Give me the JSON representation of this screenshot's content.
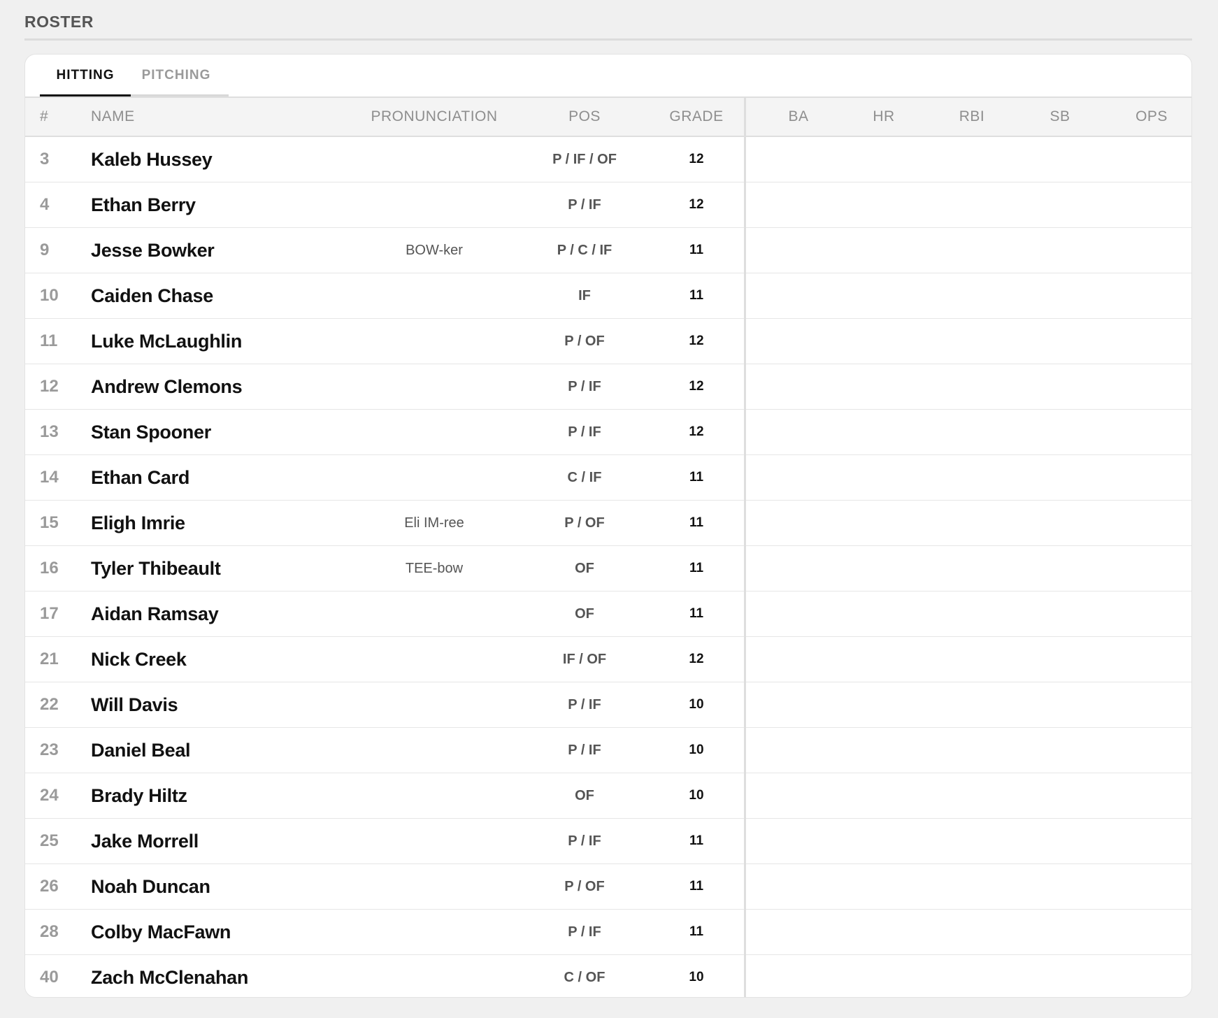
{
  "section": {
    "title": "ROSTER"
  },
  "tabs": [
    {
      "label": "HITTING",
      "active": true
    },
    {
      "label": "PITCHING",
      "active": false
    }
  ],
  "columns": {
    "num": "#",
    "name": "NAME",
    "pronunciation": "PRONUNCIATION",
    "pos": "POS",
    "grade": "GRADE",
    "ba": "BA",
    "hr": "HR",
    "rbi": "RBI",
    "sb": "SB",
    "ops": "OPS"
  },
  "players": [
    {
      "num": "3",
      "name": "Kaleb Hussey",
      "pron": "",
      "pos": "P / IF / OF",
      "grade": "12"
    },
    {
      "num": "4",
      "name": "Ethan Berry",
      "pron": "",
      "pos": "P / IF",
      "grade": "12"
    },
    {
      "num": "9",
      "name": "Jesse Bowker",
      "pron": "BOW-ker",
      "pos": "P / C / IF",
      "grade": "11"
    },
    {
      "num": "10",
      "name": "Caiden Chase",
      "pron": "",
      "pos": "IF",
      "grade": "11"
    },
    {
      "num": "11",
      "name": "Luke McLaughlin",
      "pron": "",
      "pos": "P / OF",
      "grade": "12"
    },
    {
      "num": "12",
      "name": "Andrew Clemons",
      "pron": "",
      "pos": "P / IF",
      "grade": "12"
    },
    {
      "num": "13",
      "name": "Stan Spooner",
      "pron": "",
      "pos": "P / IF",
      "grade": "12"
    },
    {
      "num": "14",
      "name": "Ethan Card",
      "pron": "",
      "pos": "C / IF",
      "grade": "11"
    },
    {
      "num": "15",
      "name": "Eligh Imrie",
      "pron": "Eli IM-ree",
      "pos": "P / OF",
      "grade": "11"
    },
    {
      "num": "16",
      "name": "Tyler Thibeault",
      "pron": "TEE-bow",
      "pos": "OF",
      "grade": "11"
    },
    {
      "num": "17",
      "name": "Aidan Ramsay",
      "pron": "",
      "pos": "OF",
      "grade": "11"
    },
    {
      "num": "21",
      "name": "Nick Creek",
      "pron": "",
      "pos": "IF / OF",
      "grade": "12"
    },
    {
      "num": "22",
      "name": "Will Davis",
      "pron": "",
      "pos": "P / IF",
      "grade": "10"
    },
    {
      "num": "23",
      "name": "Daniel Beal",
      "pron": "",
      "pos": "P / IF",
      "grade": "10"
    },
    {
      "num": "24",
      "name": "Brady Hiltz",
      "pron": "",
      "pos": "OF",
      "grade": "10"
    },
    {
      "num": "25",
      "name": "Jake Morrell",
      "pron": "",
      "pos": "P / IF",
      "grade": "11"
    },
    {
      "num": "26",
      "name": "Noah Duncan",
      "pron": "",
      "pos": "P / OF",
      "grade": "11"
    },
    {
      "num": "28",
      "name": "Colby MacFawn",
      "pron": "",
      "pos": "P / IF",
      "grade": "11"
    },
    {
      "num": "40",
      "name": "Zach McClenahan",
      "pron": "",
      "pos": "C / OF",
      "grade": "10"
    }
  ]
}
